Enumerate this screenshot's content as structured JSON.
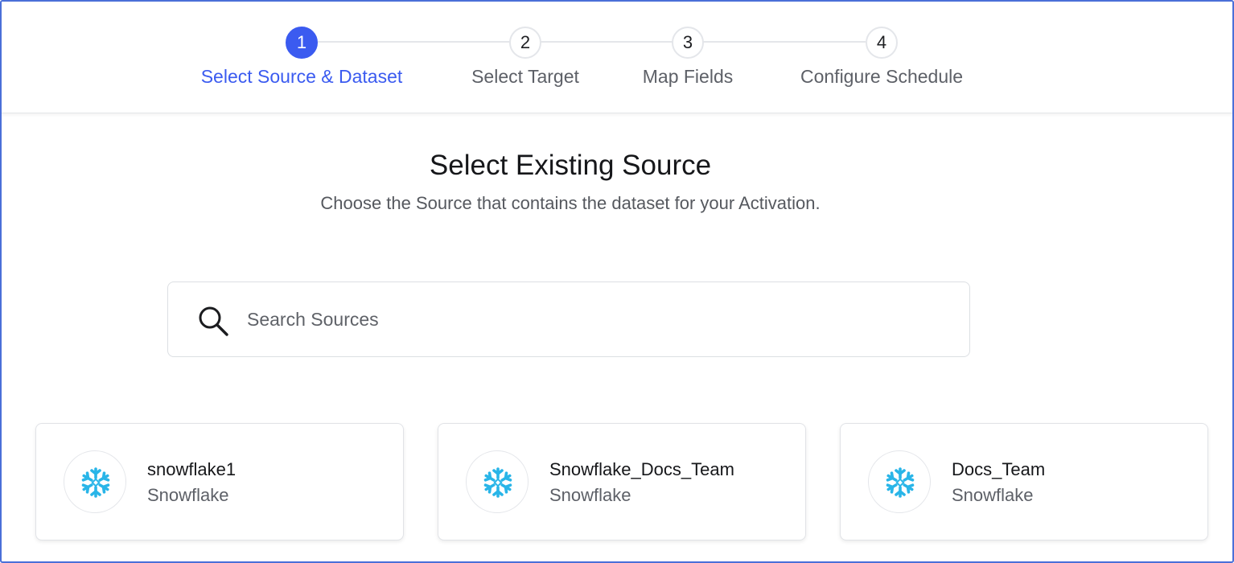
{
  "stepper": {
    "steps": [
      {
        "number": "1",
        "label": "Select Source & Dataset",
        "active": true
      },
      {
        "number": "2",
        "label": "Select Target",
        "active": false
      },
      {
        "number": "3",
        "label": "Map Fields",
        "active": false
      },
      {
        "number": "4",
        "label": "Configure Schedule",
        "active": false
      }
    ]
  },
  "main": {
    "title": "Select Existing Source",
    "subtitle": "Choose the Source that contains the dataset for your Activation."
  },
  "search": {
    "placeholder": "Search Sources",
    "value": "",
    "icon": "search-icon"
  },
  "sources": [
    {
      "name": "snowflake1",
      "type": "Snowflake",
      "icon": "snowflake-icon"
    },
    {
      "name": "Snowflake_Docs_Team",
      "type": "Snowflake",
      "icon": "snowflake-icon"
    },
    {
      "name": "Docs_Team",
      "type": "Snowflake",
      "icon": "snowflake-icon"
    }
  ],
  "colors": {
    "accent": "#3b5bf0",
    "snowflake": "#29b5e8",
    "frame_border": "#4a6fd8"
  }
}
